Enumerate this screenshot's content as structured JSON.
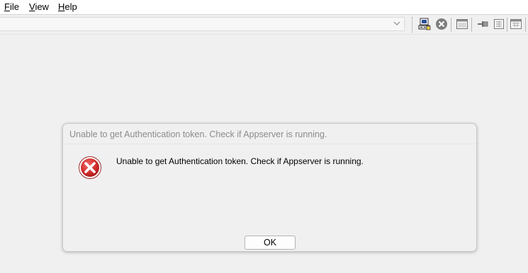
{
  "menu": {
    "file": {
      "mnemonic": "F",
      "rest": "ile"
    },
    "view": {
      "mnemonic": "V",
      "rest": "iew"
    },
    "help": {
      "mnemonic": "H",
      "rest": "elp"
    }
  },
  "toolbar": {
    "combo_value": "",
    "buttons": [
      {
        "icon": "connect-computer-icon"
      },
      {
        "icon": "stop-icon"
      },
      {
        "icon": "window-icon"
      },
      {
        "icon": "pin-icon"
      },
      {
        "icon": "list-window-icon"
      },
      {
        "icon": "calendar-window-icon"
      }
    ]
  },
  "dialog": {
    "title": "Unable to get Authentication token. Check if Appserver is running.",
    "message": "Unable to get Authentication token. Check if Appserver is running.",
    "icon": "error-icon",
    "ok_label": "OK"
  },
  "colors": {
    "error_red": "#d32f2f",
    "background": "#f0f0f0"
  }
}
